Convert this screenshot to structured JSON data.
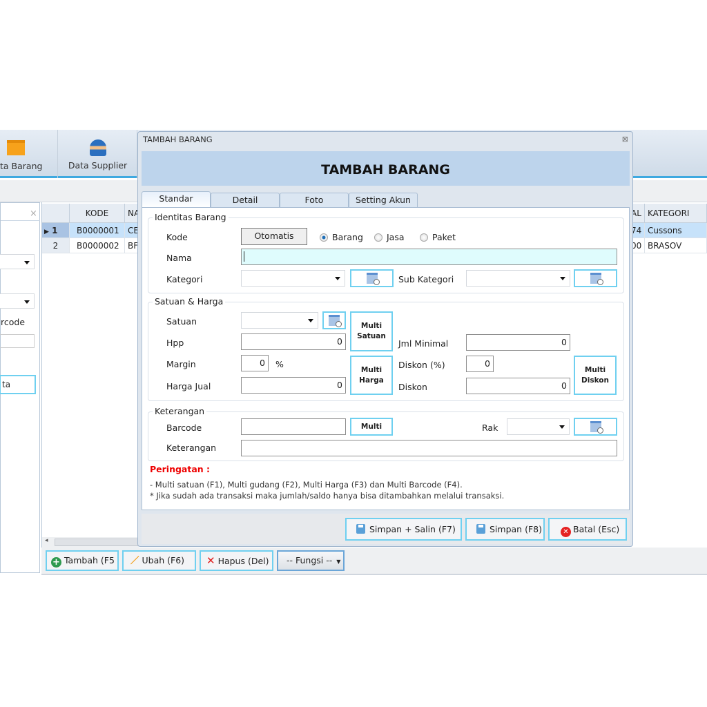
{
  "ribbon": {
    "items": [
      {
        "label": "ta Barang",
        "icon": "box-icon"
      },
      {
        "label": "Data Supplier",
        "icon": "supplier-icon"
      }
    ]
  },
  "left_panel": {
    "label_barcode": "rcode",
    "button": "ta"
  },
  "grid": {
    "headers": [
      "KODE",
      "NA",
      "AL",
      "KATEGORI"
    ],
    "rows": [
      {
        "no": "1",
        "kode": "B0000001",
        "nama": "CE",
        "al": "74",
        "kategori": "Cussons"
      },
      {
        "no": "2",
        "kode": "B0000002",
        "nama": "BF",
        "al": "00",
        "kategori": "BRASOV"
      }
    ]
  },
  "toolbar": {
    "tambah": "Tambah (F5",
    "ubah": "Ubah (F6)",
    "hapus": "Hapus (Del)",
    "fungsi": "-- Fungsi --"
  },
  "dialog": {
    "window_title": "TAMBAH BARANG",
    "header": "TAMBAH BARANG",
    "tabs": [
      "Standar",
      "Detail",
      "Foto",
      "Setting Akun"
    ],
    "identitas": {
      "title": "Identitas Barang",
      "kode_label": "Kode",
      "otomatis": "Otomatis",
      "radios": [
        {
          "label": "Barang",
          "checked": true
        },
        {
          "label": "Jasa",
          "checked": false
        },
        {
          "label": "Paket",
          "checked": false
        }
      ],
      "nama_label": "Nama",
      "nama_value": "",
      "kategori_label": "Kategori",
      "sub_kategori_label": "Sub Kategori"
    },
    "satuan": {
      "title": "Satuan & Harga",
      "satuan_label": "Satuan",
      "hpp_label": "Hpp",
      "hpp": "0",
      "margin_label": "Margin",
      "margin": "0",
      "percent": "%",
      "harga_jual_label": "Harga Jual",
      "harga_jual": "0",
      "multi_satuan": [
        "Multi",
        "Satuan"
      ],
      "multi_harga": [
        "Multi",
        "Harga"
      ],
      "jml_minimal_label": "Jml Minimal",
      "jml_minimal": "0",
      "diskon_pct_label": "Diskon (%)",
      "diskon_pct": "0",
      "diskon_label": "Diskon",
      "diskon": "0",
      "multi_diskon": [
        "Multi",
        "Diskon"
      ]
    },
    "keterangan": {
      "title": "Keterangan",
      "barcode_label": "Barcode",
      "multi": "Multi",
      "rak_label": "Rak",
      "keterangan_label": "Keterangan"
    },
    "warning": {
      "title": "Peringatan :",
      "line1": "- Multi satuan (F1), Multi gudang  (F2), Multi Harga (F3) dan Multi Barcode (F4).",
      "line2": "* Jika sudah ada transaksi maka jumlah/saldo hanya bisa ditambahkan melalui transaksi."
    },
    "buttons": {
      "simpan_salin": "Simpan + Salin (F7)",
      "simpan": "Simpan (F8)",
      "batal": "Batal (Esc)"
    }
  }
}
